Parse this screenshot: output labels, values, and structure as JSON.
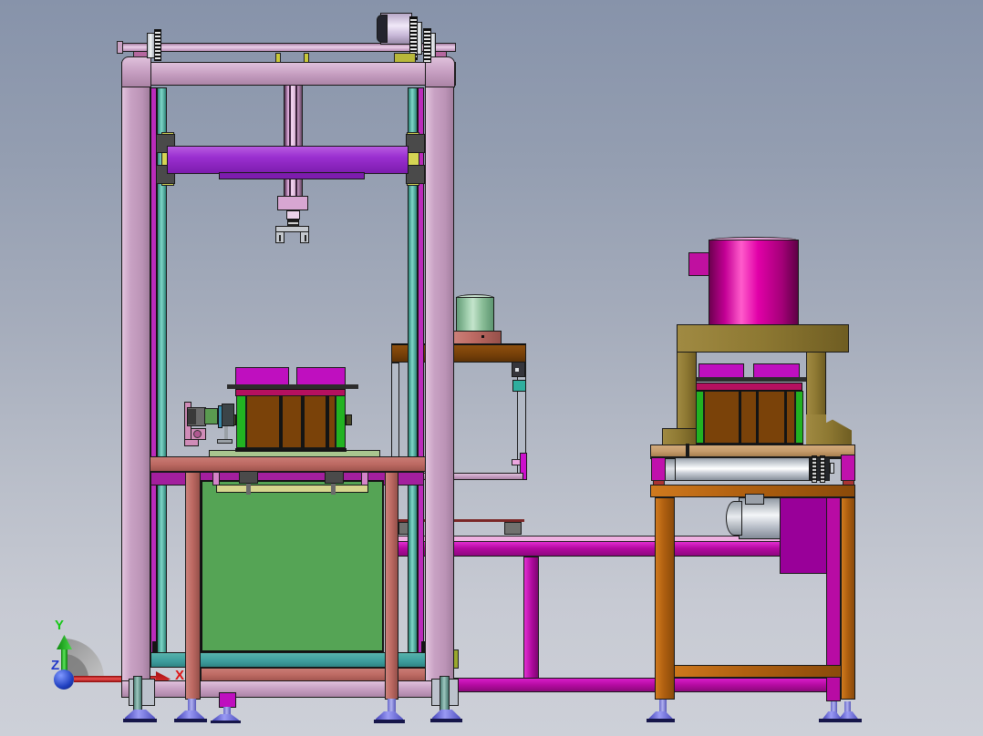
{
  "view": {
    "type": "3d-cad-model-screenshot",
    "description": "Side elevation of a two-station stacking and press machine assembly rendered in a CAD viewport",
    "background_top": "#8793aa",
    "background_bottom": "#cdd0d8"
  },
  "axis_triad": {
    "x_label": "X",
    "y_label": "Y",
    "z_label": "Z",
    "x_color": "#de1414",
    "y_color": "#16c816",
    "z_color": "#2238c8"
  },
  "palette": {
    "gantry_frame": "#c9a2c4",
    "cross_slide_beam": "#9a2fd0",
    "guide_rail_teal": "#3f9e9e",
    "rail_strip_magenta": "#bb2cbb",
    "slider_yellow": "#d5d554",
    "press_table_salmon": "#bd6a63",
    "stack_slats_brown": "#7a4209",
    "stack_ends_green": "#22b322",
    "stack_top_blocks": "#bf0fbf",
    "stack_band_crimson": "#b51060",
    "base_plate_palegreen": "#a9c68f",
    "bin_panel_green": "#55a455",
    "bottom_band_teal": "#3f9e9e",
    "clamp_bar_khaki": "#d6d68e",
    "fixture_cylinder_green": "#8cc79c",
    "side_table_top_brown": "#7a4209",
    "press_head_magenta": "#d3009f",
    "press_frame_olive": "#8d7832",
    "out_table_top_tan": "#c59b6b",
    "out_table_leg_orange": "#b06010",
    "conveyor_beam_magenta": "#c011ac",
    "conveyor_roller_silver": "#e8ebee",
    "gearmotor_silver": "#c9ced6",
    "control_panel_magenta": "#990099",
    "leveling_foot_blue": "#8080e0"
  }
}
